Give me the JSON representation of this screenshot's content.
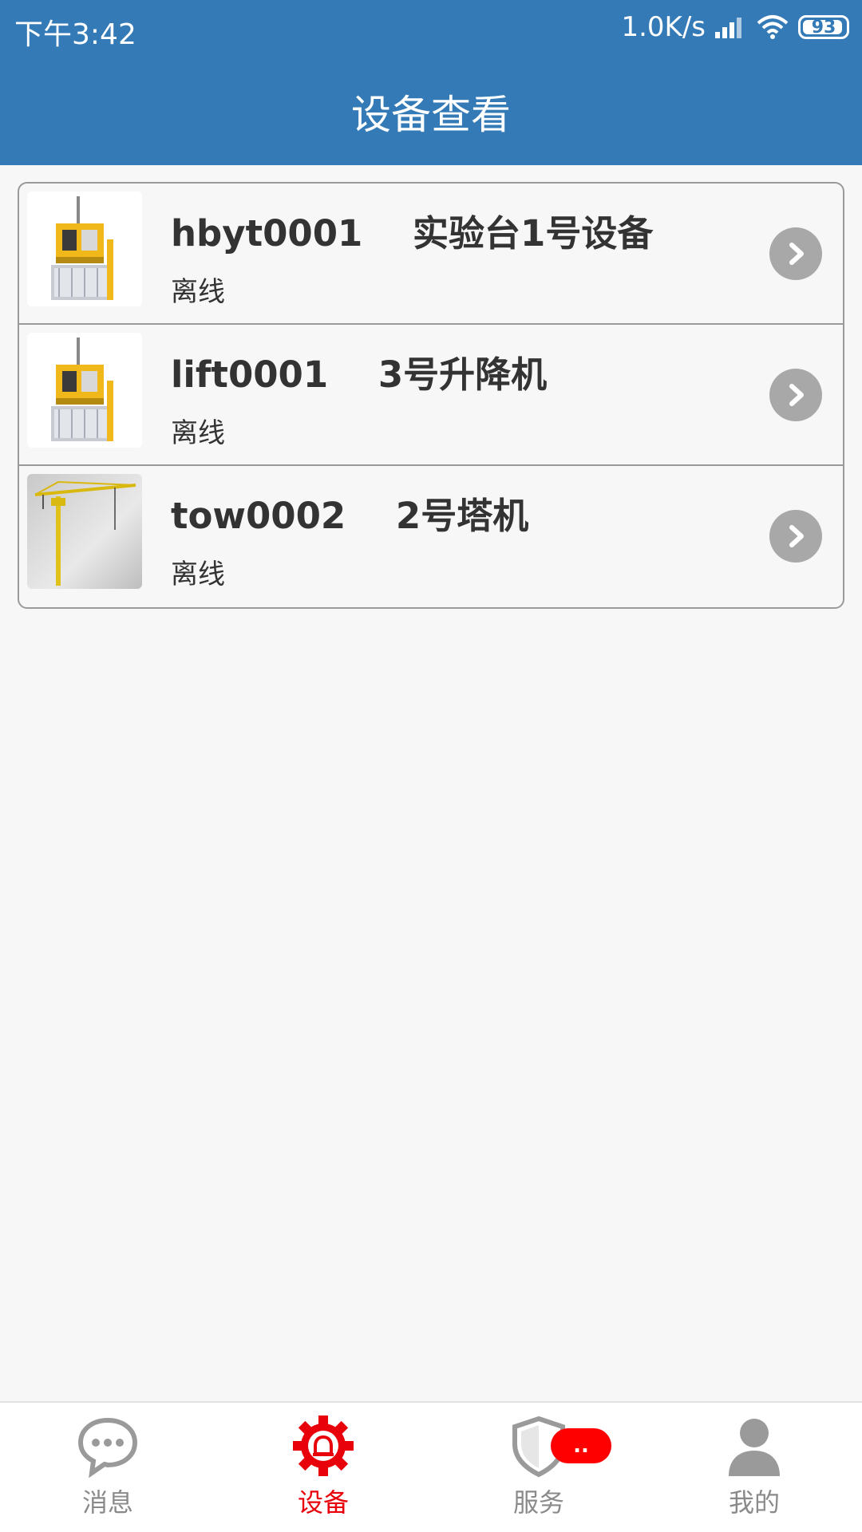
{
  "status_bar": {
    "time": "下午3:42",
    "net_speed": "1.0K/s",
    "battery": "93"
  },
  "header": {
    "title": "设备查看"
  },
  "devices": [
    {
      "id_name": "hbyt0001    实验台1号设备",
      "status": "离线",
      "thumb_icon": "lift-machine-image"
    },
    {
      "id_name": "lift0001    3号升降机",
      "status": "离线",
      "thumb_icon": "lift-machine-image"
    },
    {
      "id_name": "tow0002    2号塔机",
      "status": "离线",
      "thumb_icon": "tower-crane-image"
    }
  ],
  "nav": {
    "items": [
      {
        "label": "消息",
        "icon": "chat-bubble-icon"
      },
      {
        "label": "设备",
        "icon": "gear-alarm-icon",
        "active": true
      },
      {
        "label": "服务",
        "icon": "shield-icon",
        "badge": ".."
      },
      {
        "label": "我的",
        "icon": "person-icon"
      }
    ]
  },
  "colors": {
    "header_bg": "#337ab7",
    "active": "#e8000a",
    "inactive": "#8a8a8a",
    "badge": "#ff0000"
  }
}
